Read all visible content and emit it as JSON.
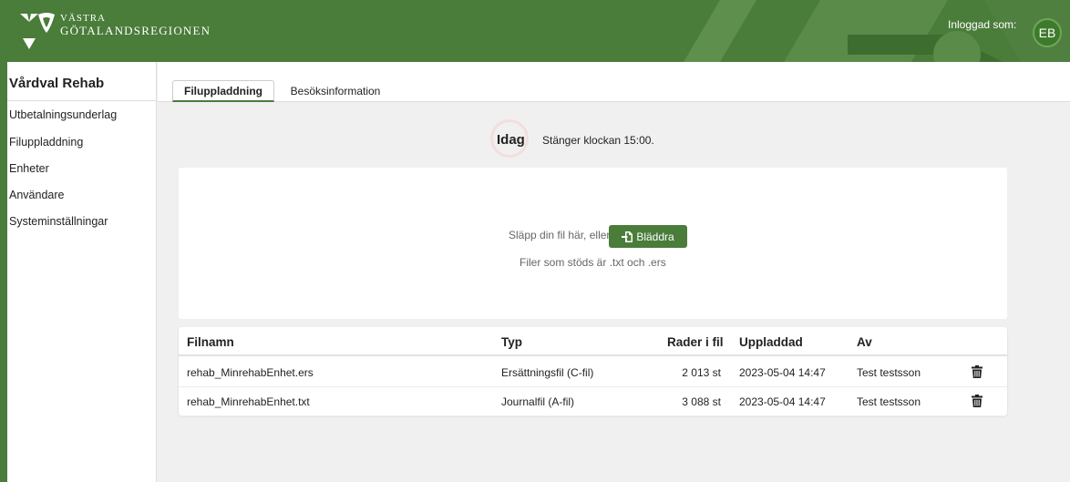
{
  "header": {
    "logo_line1": "VÄSTRA",
    "logo_line2": "GÖTALANDSREGIONEN",
    "logged_in_label": "Inloggad som:",
    "avatar_initials": "EB"
  },
  "sidebar": {
    "title": "Vårdval Rehab",
    "items": [
      {
        "label": "Utbetalningsunderlag"
      },
      {
        "label": "Filuppladdning"
      },
      {
        "label": "Enheter"
      },
      {
        "label": "Användare"
      },
      {
        "label": "Systeminställningar"
      }
    ]
  },
  "tabs": [
    {
      "label": "Filuppladdning",
      "active": true
    },
    {
      "label": "Besöksinformation",
      "active": false
    }
  ],
  "status": {
    "day_label": "Idag",
    "closing_text": "Stänger klockan 15:00."
  },
  "upload": {
    "drop_text": "Släpp din fil här, eller",
    "browse_label": "Bläddra",
    "browse_icon": "file-import-icon",
    "supported_text": "Filer som stöds är .txt och .ers"
  },
  "table": {
    "columns": [
      "Filnamn",
      "Typ",
      "Rader i fil",
      "Uppladdad",
      "Av"
    ],
    "rows": [
      {
        "filename": "rehab_MinrehabEnhet.ers",
        "type": "Ersättningsfil (C-fil)",
        "rows": "2 013 st",
        "uploaded": "2023-05-04 14:47",
        "by": "Test testsson",
        "action_icon": "trash-icon"
      },
      {
        "filename": "rehab_MinrehabEnhet.txt",
        "type": "Journalfil (A-fil)",
        "rows": "3 088 st",
        "uploaded": "2023-05-04 14:47",
        "by": "Test testsson",
        "action_icon": "trash-icon"
      }
    ]
  },
  "colors": {
    "brand_green": "#4a7c3a",
    "background": "#f0f0f0"
  }
}
